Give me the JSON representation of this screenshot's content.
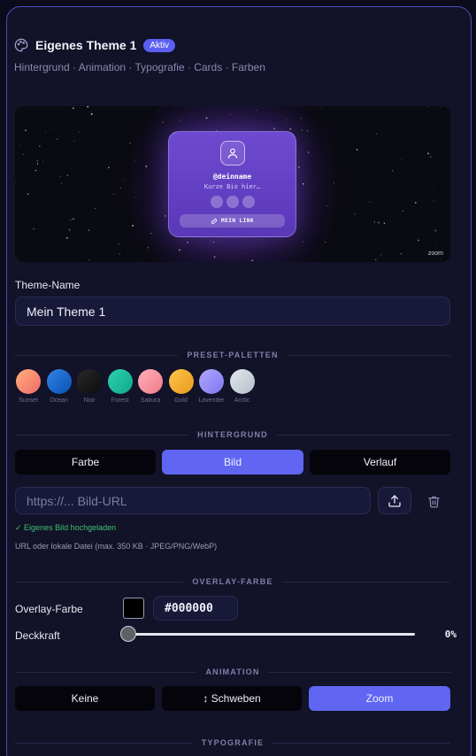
{
  "header": {
    "title": "Eigenes Theme 1",
    "badge": "Aktiv",
    "subtitle": "Hintergrund · Animation · Typografie · Cards · Farben",
    "icon": "palette-icon"
  },
  "preview": {
    "handle": "@deinname",
    "bio": "Kurze Bio hier…",
    "link_label": "MEIN LINK",
    "effect_label": "zoom"
  },
  "theme_name": {
    "label": "Theme-Name",
    "value": "Mein Theme 1"
  },
  "sections": {
    "presets": "PRESET-PALETTEN",
    "background": "HINTERGRUND",
    "overlay": "OVERLAY-FARBE",
    "animation": "ANIMATION",
    "typography": "TYPOGRAFIE"
  },
  "presets": [
    {
      "name": "Sunset",
      "colors": [
        "#ffb07a",
        "#f06a6a"
      ]
    },
    {
      "name": "Ocean",
      "colors": [
        "#2f86e8",
        "#0b4fb0"
      ]
    },
    {
      "name": "Noir",
      "colors": [
        "#2a2a2a",
        "#0b0b0b"
      ]
    },
    {
      "name": "Forest",
      "colors": [
        "#2ed3b0",
        "#0fa68a"
      ]
    },
    {
      "name": "Sakura",
      "colors": [
        "#ffb0b8",
        "#f07a8a"
      ]
    },
    {
      "name": "Gold",
      "colors": [
        "#ffc44d",
        "#e89a1a"
      ]
    },
    {
      "name": "Lavender",
      "colors": [
        "#b0a8ff",
        "#7f76f0"
      ]
    },
    {
      "name": "Arctic",
      "colors": [
        "#e2e8ee",
        "#b5bec8"
      ]
    }
  ],
  "background": {
    "options": [
      "Farbe",
      "Bild",
      "Verlauf"
    ],
    "selected": "Bild",
    "url_placeholder": "https://... Bild-URL",
    "status": "✓ Eigenes Bild hochgeladen",
    "hint": "URL oder lokale Datei (max. 350 KB · JPEG/PNG/WebP)"
  },
  "overlay": {
    "color_label": "Overlay-Farbe",
    "color_value": "#000000",
    "opacity_label": "Deckkraft",
    "opacity_value": "0%",
    "opacity": 0
  },
  "animation": {
    "options": [
      "Keine",
      "↕ Schweben",
      "Zoom"
    ],
    "selected": "Zoom"
  },
  "colors": {
    "accent": "#6066f2",
    "success": "#3ec36e",
    "border": "#4b4fb8"
  }
}
